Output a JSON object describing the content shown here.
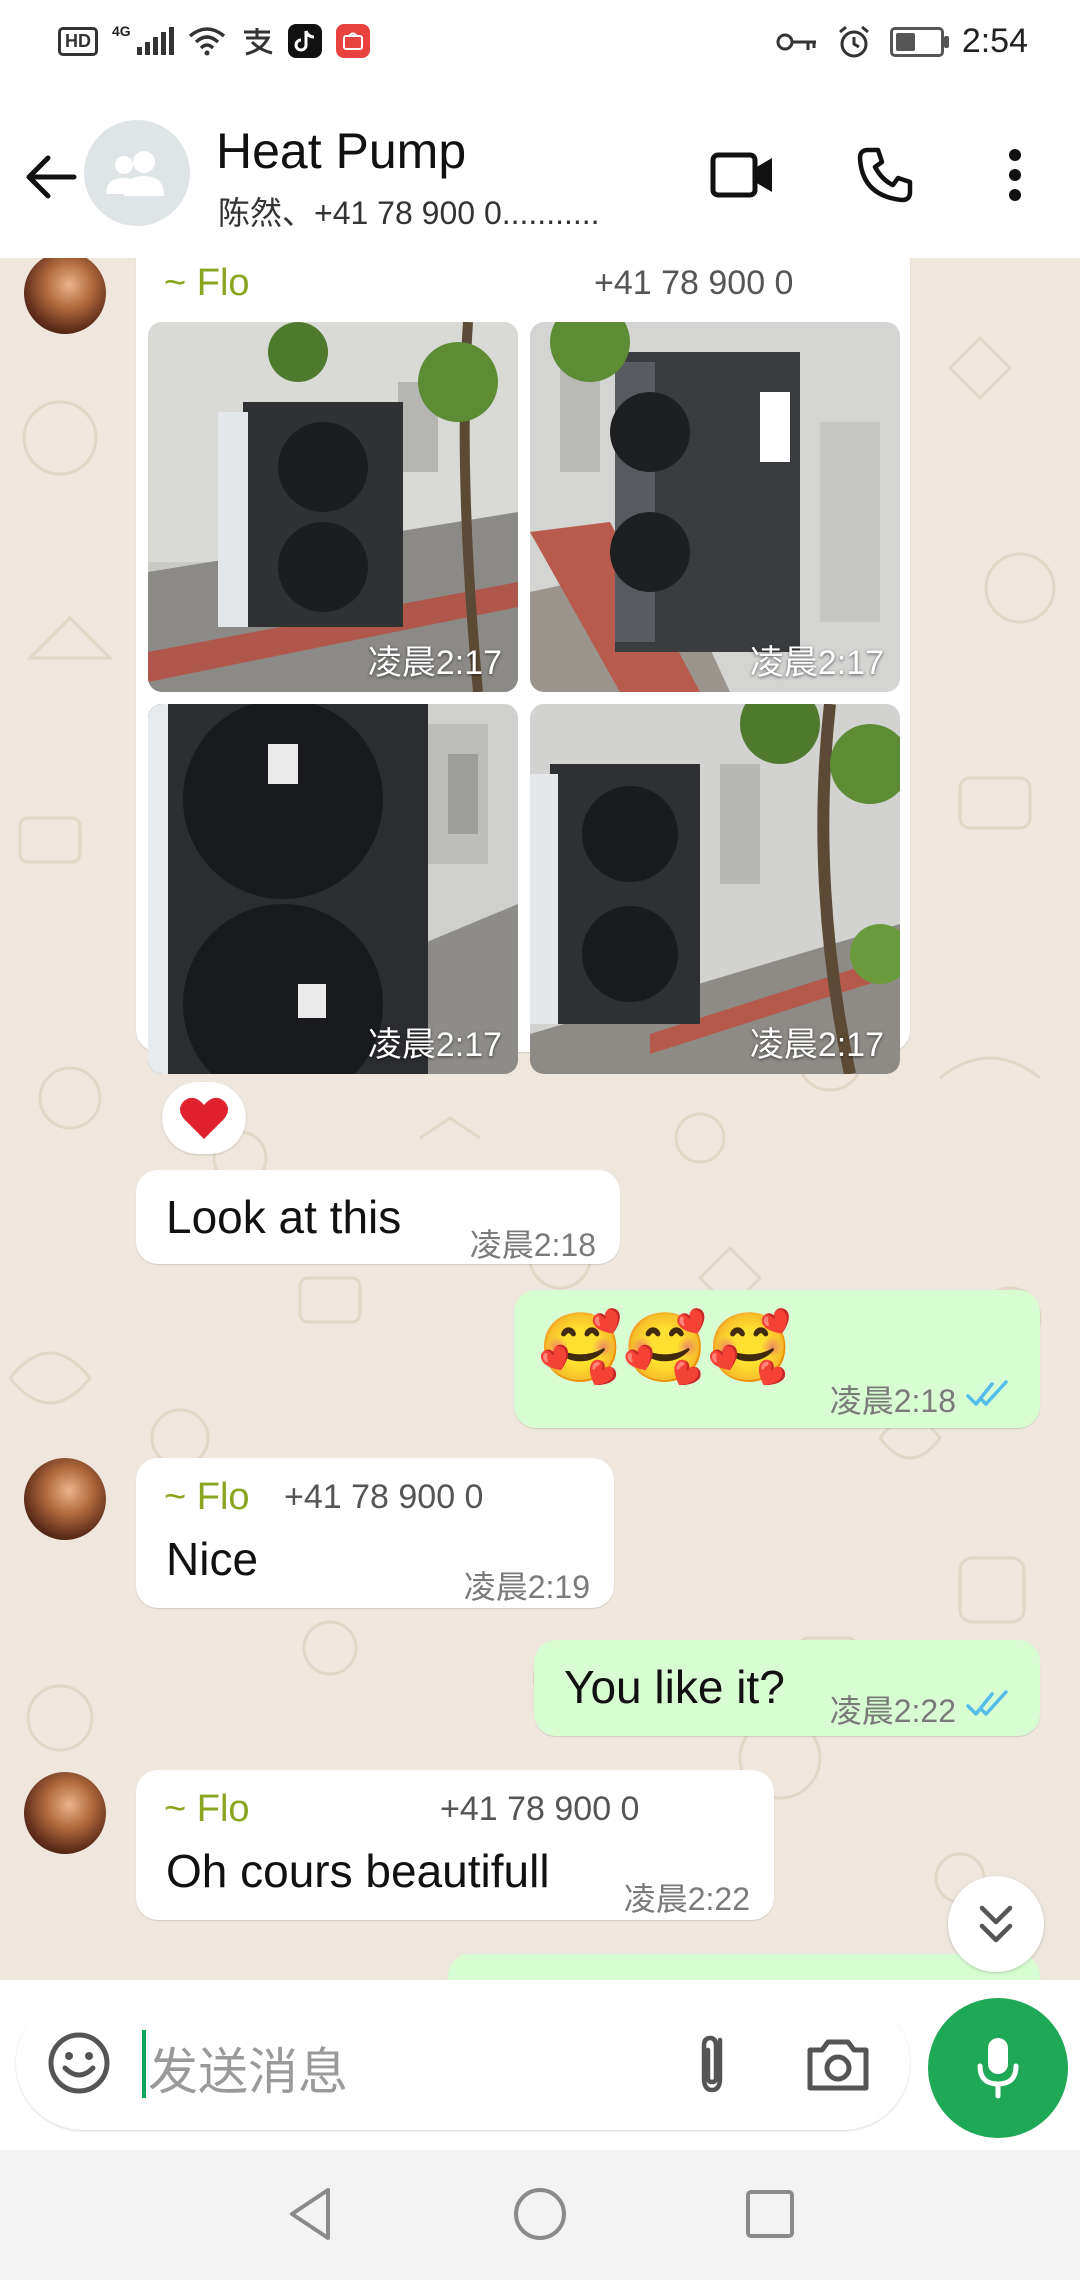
{
  "status_bar": {
    "hd": "HD",
    "network": "4G",
    "time": "2:54",
    "battery_level": 0.45
  },
  "header": {
    "title": "Heat Pump",
    "subtitle": "陈然、+41 78 900 0..........."
  },
  "messages": {
    "photo_group": {
      "sender": "~ Flo",
      "phone": "+41 78 900 0",
      "photo_times": [
        "凌晨2:17",
        "凌晨2:17",
        "凌晨2:17",
        "凌晨2:17"
      ],
      "reaction": "heart"
    },
    "m1": {
      "text": "Look at this",
      "time": "凌晨2:18"
    },
    "m2": {
      "text": "🥰🥰🥰",
      "time": "凌晨2:18"
    },
    "m3": {
      "sender": "~ Flo",
      "phone": "+41 78 900 0",
      "text": "Nice",
      "time": "凌晨2:19"
    },
    "m4": {
      "text": "You like it?",
      "time": "凌晨2:22"
    },
    "m5": {
      "sender": "~ Flo",
      "phone": "+41 78 900 0",
      "text": "Oh cours beautifull",
      "time": "凌晨2:22"
    }
  },
  "input": {
    "placeholder": "发送消息"
  },
  "colors": {
    "accent_green": "#1fa855",
    "outgoing_bubble": "#d9fdd3",
    "sender_name": "#8aa51f",
    "read_ticks": "#53bdeb",
    "chat_background": "#efe7dd"
  }
}
